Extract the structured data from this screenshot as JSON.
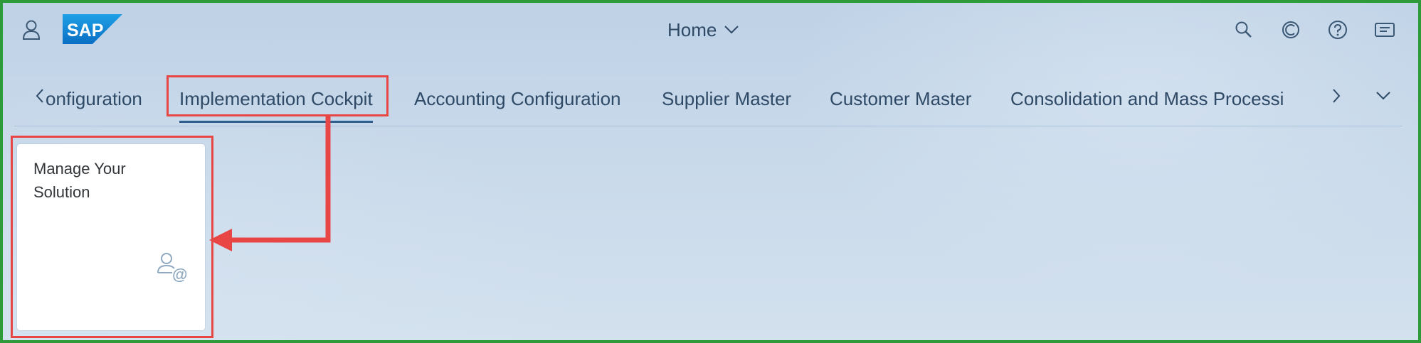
{
  "shell": {
    "home_title": "Home",
    "logo_text": "SAP",
    "icons": [
      "user-icon",
      "search-icon",
      "copilot-icon",
      "help-icon",
      "notifications-icon"
    ]
  },
  "tabs": [
    {
      "label": "onfiguration"
    },
    {
      "label": "Implementation Cockpit"
    },
    {
      "label": "Accounting Configuration"
    },
    {
      "label": "Supplier Master"
    },
    {
      "label": "Customer Master"
    },
    {
      "label": "Consolidation and Mass Processi"
    }
  ],
  "tile": {
    "title": "Manage Your Solution",
    "icon": "user-at-icon"
  },
  "colors": {
    "annotation": "#e84545",
    "frame": "#2e9a3a",
    "text": "#2f4a66"
  }
}
